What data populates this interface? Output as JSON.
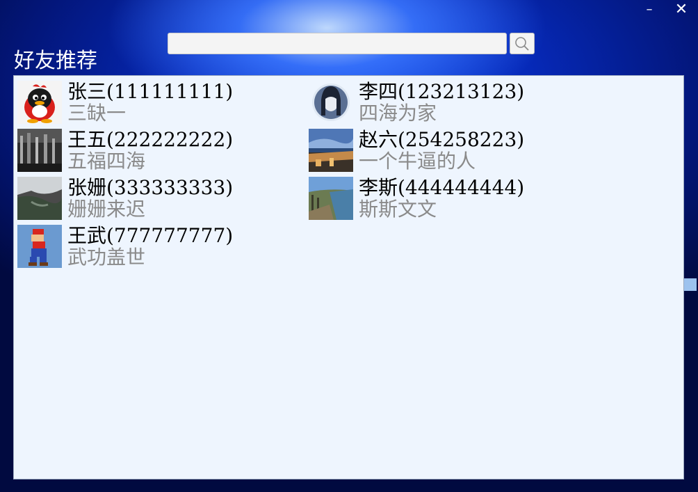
{
  "window": {
    "minimize_glyph": "–",
    "close_glyph": "✕"
  },
  "search": {
    "value": "",
    "placeholder": "",
    "button_icon": "search-icon"
  },
  "title": "好友推荐",
  "friends": [
    {
      "name": "张三(111111111)",
      "motto": "三缺一",
      "avatar": "qq-penguin-avatar"
    },
    {
      "name": "李四(123213123)",
      "motto": "四海为家",
      "avatar": "girl-portrait-avatar"
    },
    {
      "name": "王五(222222222)",
      "motto": "五福四海",
      "avatar": "dark-landscape-avatar"
    },
    {
      "name": "赵六(254258223)",
      "motto": "一个牛逼的人",
      "avatar": "city-night-avatar"
    },
    {
      "name": "张姗(333333333)",
      "motto": "姗姗来迟",
      "avatar": "foggy-valley-avatar"
    },
    {
      "name": "李斯(444444444)",
      "motto": "斯斯文文",
      "avatar": "coast-landscape-avatar"
    },
    {
      "name": "王武(777777777)",
      "motto": "武功盖世",
      "avatar": "mario-avatar"
    }
  ],
  "colors": {
    "panel_bg": "#eef5fe",
    "name": "#000000",
    "motto": "#8a8a8a",
    "bg_blue": "#0629b8"
  }
}
